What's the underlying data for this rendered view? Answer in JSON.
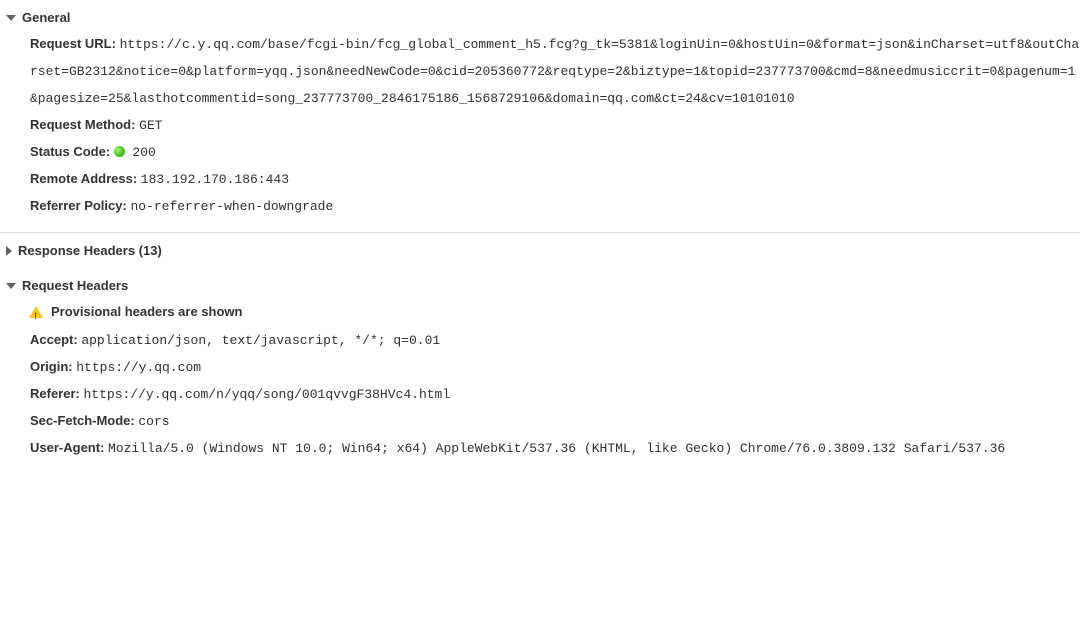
{
  "general": {
    "title": "General",
    "request_url_label": "Request URL:",
    "request_url_value": "https://c.y.qq.com/base/fcgi-bin/fcg_global_comment_h5.fcg?g_tk=5381&loginUin=0&hostUin=0&format=json&inCharset=utf8&outCharset=GB2312&notice=0&platform=yqq.json&needNewCode=0&cid=205360772&reqtype=2&biztype=1&topid=237773700&cmd=8&needmusiccrit=0&pagenum=1&pagesize=25&lasthotcommentid=song_237773700_2846175186_1568729106&domain=qq.com&ct=24&cv=10101010",
    "request_method_label": "Request Method:",
    "request_method_value": "GET",
    "status_code_label": "Status Code:",
    "status_code_value": "200",
    "remote_address_label": "Remote Address:",
    "remote_address_value": "183.192.170.186:443",
    "referrer_policy_label": "Referrer Policy:",
    "referrer_policy_value": "no-referrer-when-downgrade"
  },
  "response_headers": {
    "title": "Response Headers",
    "count": "(13)"
  },
  "request_headers": {
    "title": "Request Headers",
    "provisional_warning": "Provisional headers are shown",
    "accept_label": "Accept:",
    "accept_value": "application/json, text/javascript, */*; q=0.01",
    "origin_label": "Origin:",
    "origin_value": "https://y.qq.com",
    "referer_label": "Referer:",
    "referer_value": "https://y.qq.com/n/yqq/song/001qvvgF38HVc4.html",
    "sec_fetch_mode_label": "Sec-Fetch-Mode:",
    "sec_fetch_mode_value": "cors",
    "user_agent_label": "User-Agent:",
    "user_agent_value": "Mozilla/5.0 (Windows NT 10.0; Win64; x64) AppleWebKit/537.36 (KHTML, like Gecko) Chrome/76.0.3809.132 Safari/537.36"
  }
}
